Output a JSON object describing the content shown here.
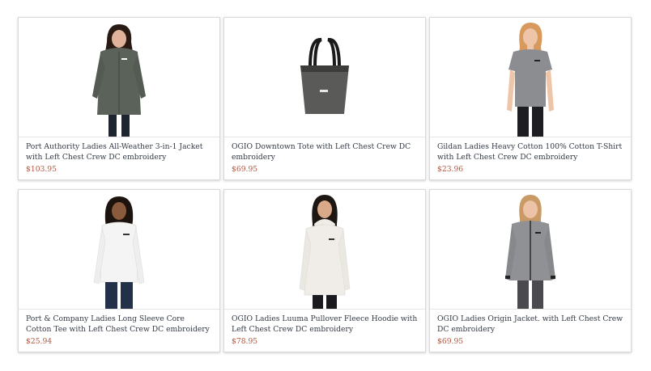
{
  "products": [
    {
      "name": "Port Authority Ladies All-Weather 3-in-1 Jacket with Left Chest Crew DC embroidery",
      "price": "$103.95",
      "image_icon": "jacket-woman-image"
    },
    {
      "name": "OGIO Downtown Tote with Left Chest Crew DC embroidery",
      "price": "$69.95",
      "image_icon": "tote-bag-image"
    },
    {
      "name": "Gildan Ladies Heavy Cotton 100% Cotton T-Shirt with Left Chest Crew DC embroidery",
      "price": "$23.96",
      "image_icon": "tshirt-woman-image"
    },
    {
      "name": "Port & Company Ladies Long Sleeve Core Cotton Tee with Left Chest Crew DC embroidery",
      "price": "$25.94",
      "image_icon": "longsleeve-woman-image"
    },
    {
      "name": "OGIO Ladies Luuma Pullover Fleece Hoodie with Left Chest Crew DC embroidery",
      "price": "$78.95",
      "image_icon": "hoodie-woman-image"
    },
    {
      "name": "OGIO Ladies Origin Jacket. with Left Chest Crew DC embroidery",
      "price": "$69.95",
      "image_icon": "fleece-jacket-woman-image"
    }
  ],
  "colors": {
    "price": "#b0553e",
    "title": "#333a44",
    "border": "#d9d9d9"
  }
}
